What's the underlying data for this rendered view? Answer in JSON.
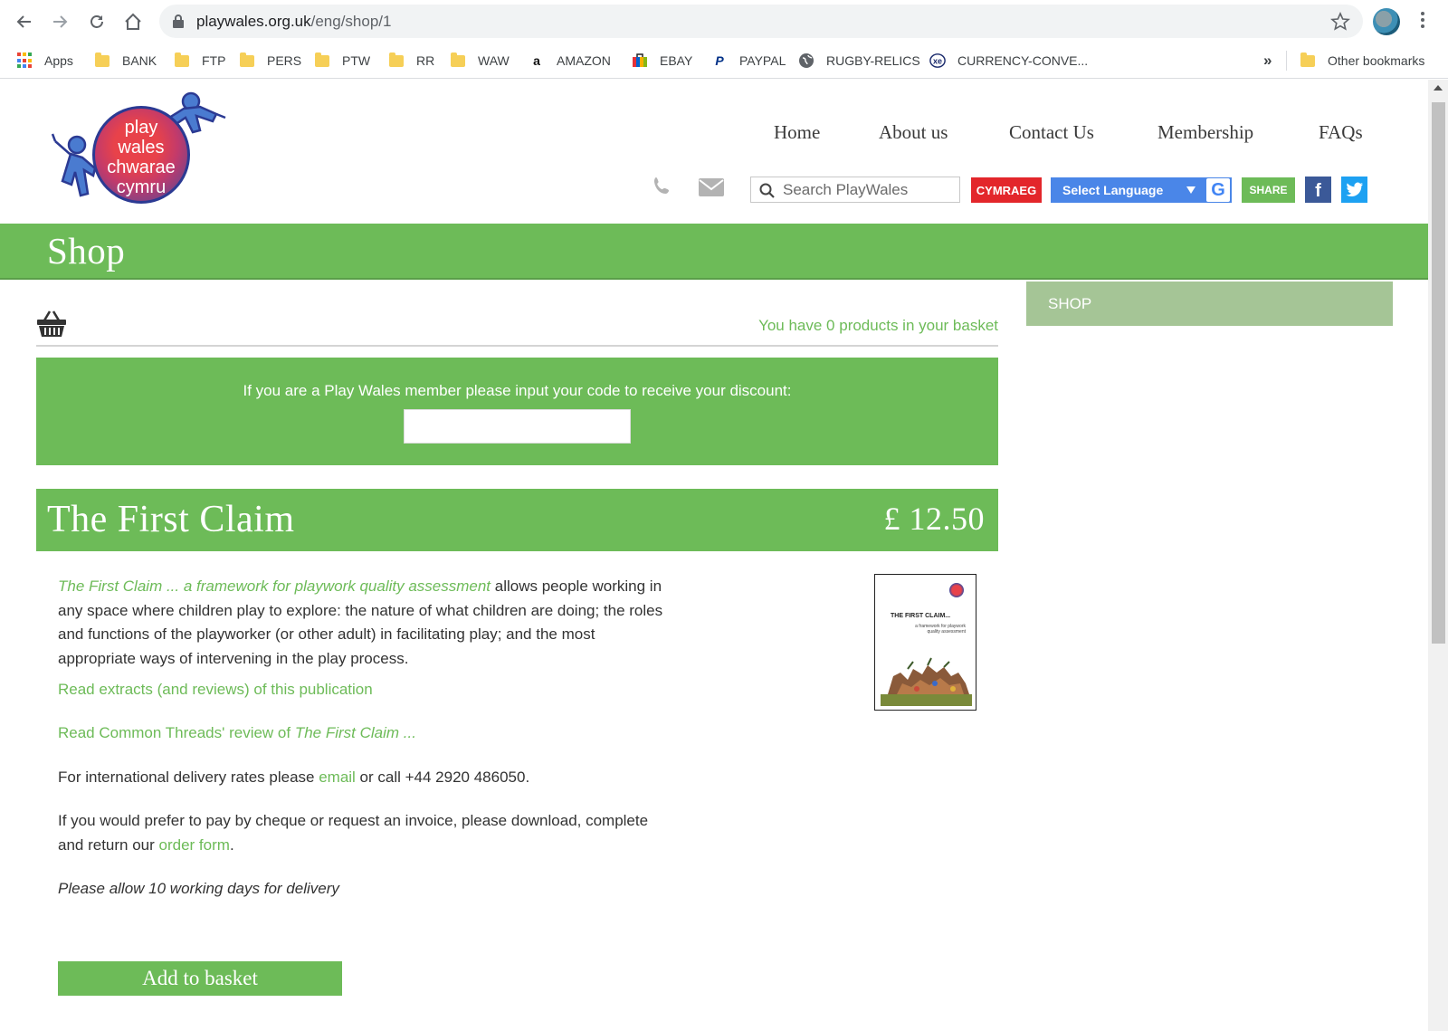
{
  "browser": {
    "url_domain": "playwales.org.uk",
    "url_path": "/eng/shop/1",
    "bookmarks": [
      {
        "label": "Apps",
        "icon": "apps-grid-icon"
      },
      {
        "label": "BANK",
        "icon": "folder-icon"
      },
      {
        "label": "FTP",
        "icon": "folder-icon"
      },
      {
        "label": "PERS",
        "icon": "folder-icon"
      },
      {
        "label": "PTW",
        "icon": "folder-icon"
      },
      {
        "label": "RR",
        "icon": "folder-icon"
      },
      {
        "label": "WAW",
        "icon": "folder-icon"
      },
      {
        "label": "AMAZON",
        "icon": "amazon-icon"
      },
      {
        "label": "EBAY",
        "icon": "ebay-icon"
      },
      {
        "label": "PAYPAL",
        "icon": "paypal-icon"
      },
      {
        "label": "RUGBY-RELICS",
        "icon": "globe-icon"
      },
      {
        "label": "CURRENCY-CONVE...",
        "icon": "xe-icon"
      }
    ],
    "overflow_label": "»",
    "other_bookmarks": "Other bookmarks"
  },
  "site": {
    "logo_lines": [
      "play",
      "wales",
      "chwarae",
      "cymru"
    ],
    "nav": [
      "Home",
      "About us",
      "Contact Us",
      "Membership",
      "FAQs"
    ],
    "search_placeholder": "Search PlayWales",
    "cymraeg_label": "CYMRAEG",
    "language_label": "Select Language",
    "google_label": "G",
    "share_label": "SHARE",
    "facebook_label": "f"
  },
  "shop": {
    "heading": "Shop",
    "basket_text": "You have 0 products in your basket",
    "discount_prompt": "If you are a Play Wales member please input your code to receive your discount:",
    "discount_value": "",
    "sidebar_item": "SHOP"
  },
  "product": {
    "title": "The First Claim",
    "price": "£ 12.50",
    "description_link": "The First Claim ... a framework for playwork quality assessment",
    "description_rest": " allows people working in any space where children play to explore: the nature of what children are doing; the roles and functions of the playworker (or other adult) in facilitating play; and the most appropriate ways of intervening in the play process.",
    "extracts_link": "Read extracts (and reviews) of this publication",
    "review_link_prefix": "Read Common Threads' review of ",
    "review_link_title": "The First Claim ...",
    "intl_prefix": "For international delivery rates please ",
    "intl_link": "email",
    "intl_suffix": " or call +44 2920 486050.",
    "cheque_prefix": "If you would prefer to pay by cheque or request an invoice, please download, complete and return our ",
    "cheque_link": "order form",
    "cheque_suffix": ".",
    "delivery_note": "Please allow 10 working days for delivery",
    "add_button": "Add to basket",
    "book_cover_title": "THE FIRST CLAIM...",
    "book_cover_subtitle": "a framework for playwork quality assessment"
  },
  "colors": {
    "brand_green": "#6dbb58",
    "sidebar_green": "#a5c596",
    "cymraeg_red": "#e3262b",
    "translate_blue": "#4a86e8",
    "facebook_blue": "#3b5998",
    "twitter_blue": "#1da1f2"
  }
}
